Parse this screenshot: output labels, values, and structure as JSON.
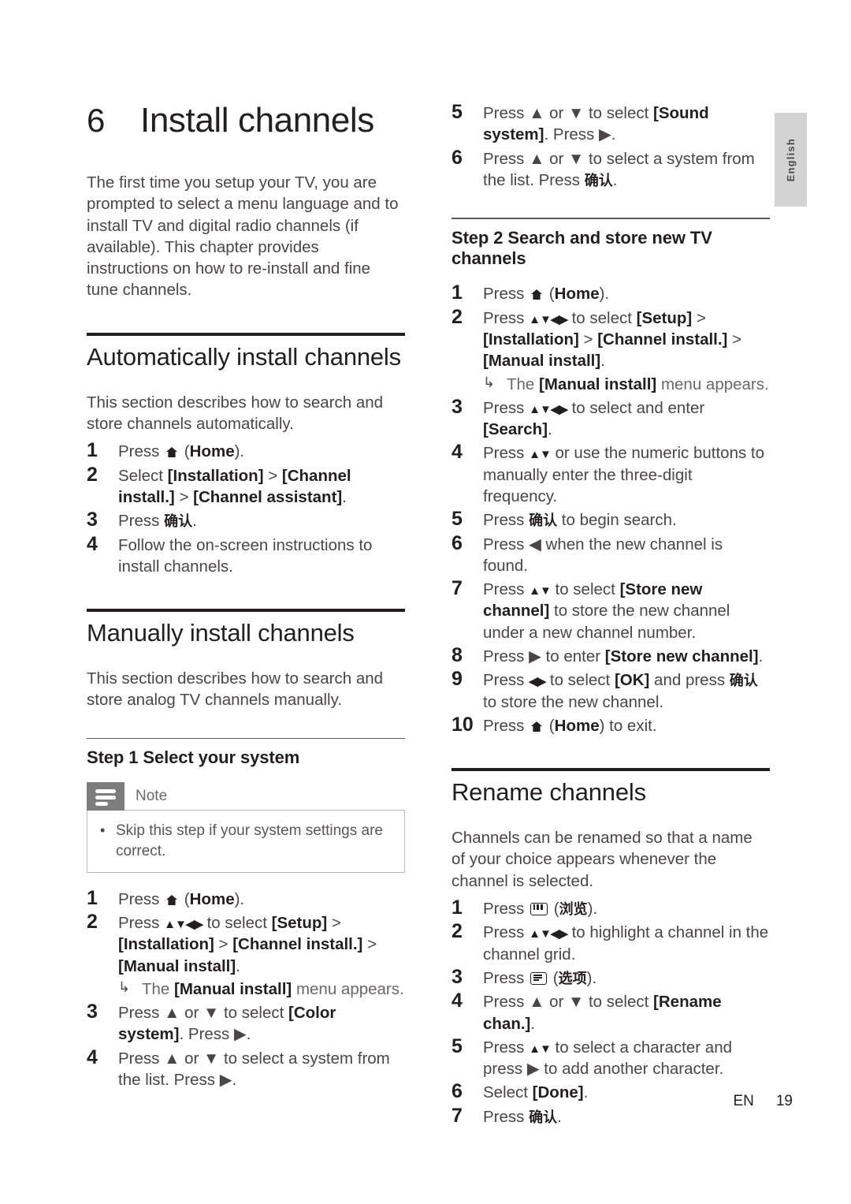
{
  "language_tab": {
    "label": "English"
  },
  "chapter": {
    "number": "6",
    "title": "Install channels"
  },
  "intro": "The first time you setup your TV, you are prompted to select a menu language and to install TV and digital radio channels (if available). This chapter provides instructions on how to re-install and fine tune channels.",
  "sections": {
    "auto": {
      "heading": "Automatically install channels",
      "intro": "This section describes how to search and store channels automatically.",
      "steps": [
        {
          "n": "1",
          "pre": "Press ",
          "icon": "home-icon",
          "post": " (",
          "bold": "Home",
          "tail": ")."
        },
        {
          "n": "2",
          "text_a": "Select ",
          "b1": "[Installation]",
          "sep1": " > ",
          "b2": "[Channel install.]",
          "sep2": " > ",
          "b3": "[Channel assistant]",
          "tail": "."
        },
        {
          "n": "3",
          "pre": "Press ",
          "cn": "确认",
          "tail": "."
        },
        {
          "n": "4",
          "text": "Follow the on-screen instructions to install channels."
        }
      ]
    },
    "manual": {
      "heading": "Manually install channels",
      "intro": "This section describes how to search and store analog TV channels manually.",
      "step1": {
        "heading": "Step 1 Select your system",
        "note": {
          "title": "Note",
          "items": [
            "Skip this step if your system settings are correct."
          ]
        },
        "steps": [
          {
            "n": "1",
            "pre": "Press ",
            "icon": "home-icon",
            "post": " (",
            "bold": "Home",
            "tail": ")."
          },
          {
            "n": "2",
            "pre": "Press ",
            "arrows": "▲▼◀▶",
            "mid": " to select ",
            "b1": "[Setup]",
            "sep1": " > ",
            "b2": "[Installation]",
            "sep2": " > ",
            "b3": "[Channel install.]",
            "sep3": " > ",
            "b4": "[Manual install]",
            "tail": ".",
            "sub": {
              "arrow": "↳",
              "pre": "The ",
              "bold": "[Manual install]",
              "post": " menu appears."
            }
          },
          {
            "n": "3",
            "pre": "Press ▲ or ▼ to select ",
            "bold": "[Color system]",
            "tail": ". Press ▶."
          },
          {
            "n": "4",
            "text": "Press ▲ or ▼ to select a system from the list. Press ▶."
          },
          {
            "n": "5",
            "pre": "Press ▲ or ▼ to select ",
            "bold": "[Sound system]",
            "tail": ". Press ▶."
          },
          {
            "n": "6",
            "pre": "Press ▲ or ▼ to select a system from the list. Press ",
            "cn": "确认",
            "tail": "."
          }
        ]
      },
      "step2": {
        "heading": "Step 2 Search and store new TV channels",
        "steps": [
          {
            "n": "1",
            "pre": "Press ",
            "icon": "home-icon",
            "post": " (",
            "bold": "Home",
            "tail": ")."
          },
          {
            "n": "2",
            "pre": "Press ",
            "arrows": "▲▼◀▶",
            "mid": " to select ",
            "b1": "[Setup]",
            "sep1": " > ",
            "b2": "[Installation]",
            "sep2": " > ",
            "b3": "[Channel install.]",
            "sep3": " > ",
            "b4": "[Manual install]",
            "tail": ".",
            "sub": {
              "arrow": "↳",
              "pre": "The ",
              "bold": "[Manual install]",
              "post": " menu appears."
            }
          },
          {
            "n": "3",
            "pre": "Press ",
            "arrows": "▲▼◀▶",
            "mid": " to select and enter ",
            "bold": "[Search]",
            "tail": "."
          },
          {
            "n": "4",
            "pre": "Press ",
            "arrows": "▲▼",
            "mid": " or use the numeric buttons to manually enter the three-digit frequency."
          },
          {
            "n": "5",
            "pre": "Press ",
            "cn": "确认",
            "tail": " to begin search."
          },
          {
            "n": "6",
            "text": "Press ◀ when the new channel is found."
          },
          {
            "n": "7",
            "pre": "Press ",
            "arrows": "▲▼",
            "mid": " to select ",
            "bold": "[Store new channel]",
            "tail": " to store the new channel under a new channel number."
          },
          {
            "n": "8",
            "pre": "Press ▶ to enter ",
            "bold": "[Store new channel]",
            "tail": "."
          },
          {
            "n": "9",
            "pre": "Press ",
            "arrows": "◀▶",
            "mid": " to select ",
            "bold": "[OK]",
            "mid2": " and press ",
            "cn": "确认",
            "tail": " to store the new channel."
          },
          {
            "n": "10",
            "pre": "Press ",
            "icon": "home-icon",
            "post": " (",
            "bold": "Home",
            "tail": ") to exit."
          }
        ]
      }
    },
    "rename": {
      "heading": "Rename channels",
      "intro": "Channels can be renamed so that a name of your choice appears whenever the channel is selected.",
      "steps": [
        {
          "n": "1",
          "pre": "Press ",
          "icon": "browse-icon",
          "post": " (",
          "cn": "浏览",
          "tail": ")."
        },
        {
          "n": "2",
          "pre": "Press ",
          "arrows": "▲▼◀▶",
          "mid": " to highlight a channel in the channel grid."
        },
        {
          "n": "3",
          "pre": "Press ",
          "icon": "options-icon",
          "post": " (",
          "cn": "选项",
          "tail": ")."
        },
        {
          "n": "4",
          "pre": "Press ▲ or ▼ to select ",
          "bold": "[Rename chan.]",
          "tail": "."
        },
        {
          "n": "5",
          "pre": "Press ",
          "arrows": "▲▼",
          "mid": " to select a character and press ▶ to add another character."
        },
        {
          "n": "6",
          "pre": "Select ",
          "bold": "[Done]",
          "tail": "."
        },
        {
          "n": "7",
          "pre": "Press ",
          "cn": "确认",
          "tail": "."
        }
      ]
    }
  },
  "footer": {
    "lang_code": "EN",
    "page_number": "19"
  }
}
